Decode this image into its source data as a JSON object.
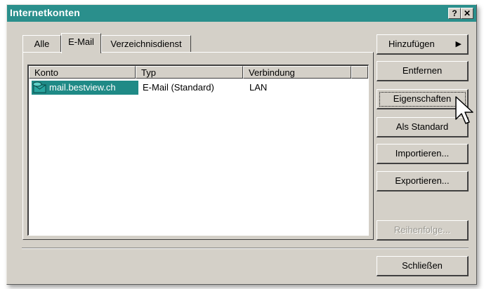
{
  "window": {
    "title": "Internetkonten",
    "help_label": "?",
    "close_label": "✕"
  },
  "tabs": [
    {
      "label": "Alle",
      "active": false
    },
    {
      "label": "E-Mail",
      "active": true
    },
    {
      "label": "Verzeichnisdienst",
      "active": false
    }
  ],
  "list": {
    "columns": [
      "Konto",
      "Typ",
      "Verbindung"
    ],
    "rows": [
      {
        "konto": "mail.bestview.ch",
        "typ": "E-Mail (Standard)",
        "verbindung": "LAN",
        "selected": true,
        "icon": "mail-account-icon"
      }
    ]
  },
  "buttons": {
    "add": "Hinzufügen",
    "remove": "Entfernen",
    "properties": "Eigenschaften",
    "set_default": "Als Standard",
    "import": "Importieren...",
    "export": "Exportieren...",
    "order": "Reihenfolge...",
    "close": "Schließen"
  },
  "colors": {
    "titlebar": "#2a8f8c",
    "selection": "#1f8a86",
    "face": "#d4d0c8"
  }
}
